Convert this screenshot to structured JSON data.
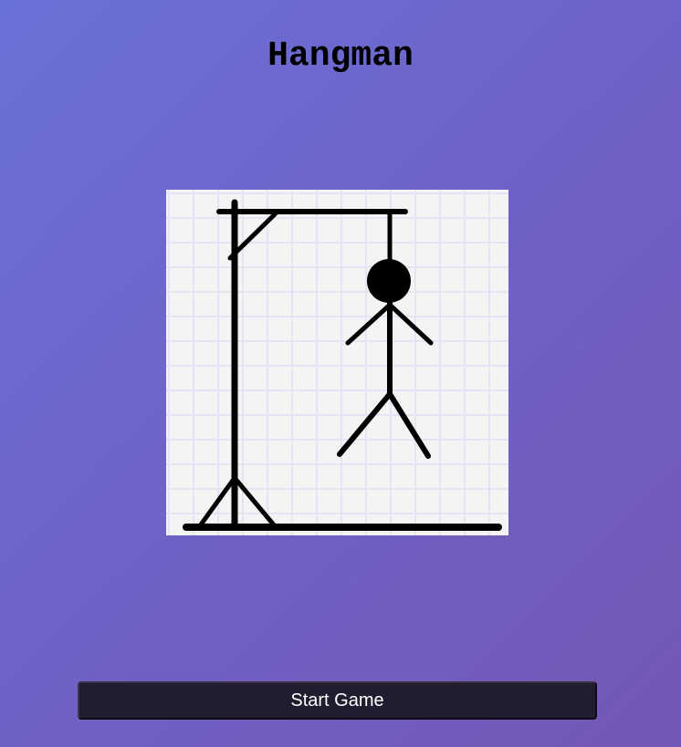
{
  "game": {
    "title": "Hangman",
    "wrong_guesses": 6,
    "max_wrong_guesses": 6
  },
  "hangman_image": {
    "figure": "hangman-drawing",
    "parts_shown": [
      "gallows",
      "head",
      "body",
      "left-arm",
      "right-arm",
      "left-leg",
      "right-leg"
    ]
  },
  "controls": {
    "start_label": "Start Game"
  },
  "colors": {
    "background_start": "#6a71d8",
    "background_end": "#7457b4",
    "button_bg": "#221c30",
    "button_text": "#ffffff",
    "drawing_ink": "#000000",
    "grid_line": "#e4e4f4"
  }
}
